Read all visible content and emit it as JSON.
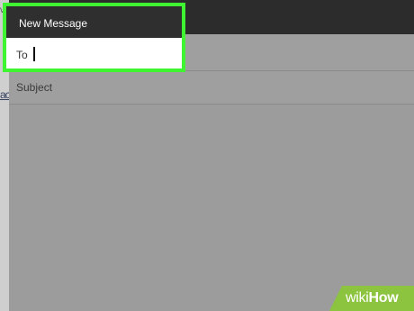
{
  "window": {
    "title": "New Message"
  },
  "fields": {
    "to_label": "To",
    "subject_label": "Subject"
  },
  "background": {
    "fragment_top": "v",
    "fragment_link": "ac"
  },
  "watermark": {
    "wiki": "wiki",
    "how": "How"
  },
  "colors": {
    "highlight": "#3ff431",
    "titlebar": "#2c2c2c",
    "overlay_gray": "#9c9c9c",
    "watermark_green": "#8cc43f"
  }
}
